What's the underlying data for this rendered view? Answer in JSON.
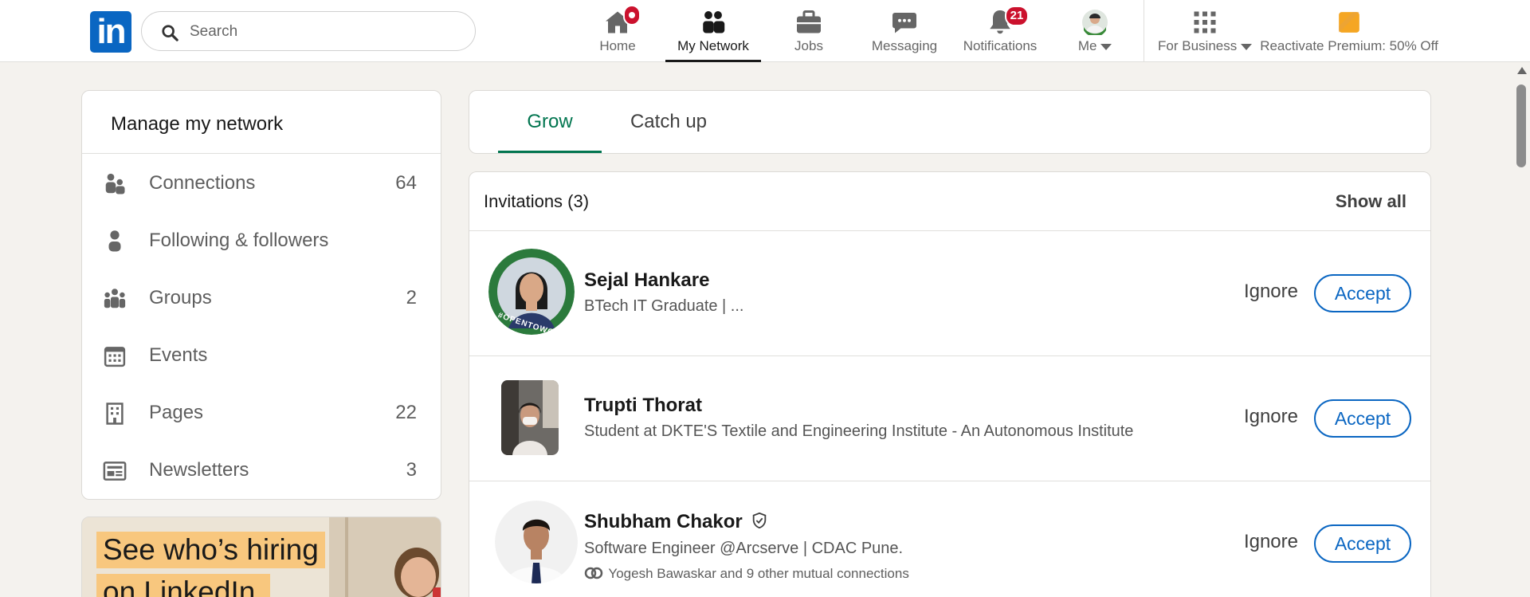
{
  "search": {
    "placeholder": "Search"
  },
  "nav": {
    "home": "Home",
    "network": "My Network",
    "jobs": "Jobs",
    "messaging": "Messaging",
    "notifications": "Notifications",
    "notifications_count": "21",
    "me": "Me",
    "business": "For Business",
    "premium": "Reactivate Premium: 50% Off"
  },
  "sidebar": {
    "title": "Manage my network",
    "items": [
      {
        "label": "Connections",
        "count": "64",
        "icon": "people-icon"
      },
      {
        "label": "Following & followers",
        "count": "",
        "icon": "person-icon"
      },
      {
        "label": "Groups",
        "count": "2",
        "icon": "group-icon"
      },
      {
        "label": "Events",
        "count": "",
        "icon": "calendar-icon"
      },
      {
        "label": "Pages",
        "count": "22",
        "icon": "building-icon"
      },
      {
        "label": "Newsletters",
        "count": "3",
        "icon": "newspaper-icon"
      }
    ]
  },
  "promo": {
    "line1": "See who’s hiring",
    "line2": "on LinkedIn."
  },
  "tabs": [
    "Grow",
    "Catch up"
  ],
  "invitations": {
    "header": "Invitations (3)",
    "show_all": "Show all",
    "ignore_label": "Ignore",
    "accept_label": "Accept",
    "items": [
      {
        "name": "Sejal Hankare",
        "headline": "BTech IT Graduate | ...",
        "mutual": "",
        "photo_badge": "#OPENTOWORK"
      },
      {
        "name": "Trupti Thorat",
        "headline": "Student at DKTE'S Textile and Engineering Institute - An Autonomous Institute",
        "mutual": ""
      },
      {
        "name": "Shubham Chakor",
        "headline": "Software Engineer @Arcserve | CDAC Pune.",
        "mutual": "Yogesh Bawaskar and 9 other mutual connections"
      }
    ]
  },
  "colors": {
    "brand": "#0a66c2",
    "active_tab": "#01754f",
    "badge": "#cb112d"
  }
}
